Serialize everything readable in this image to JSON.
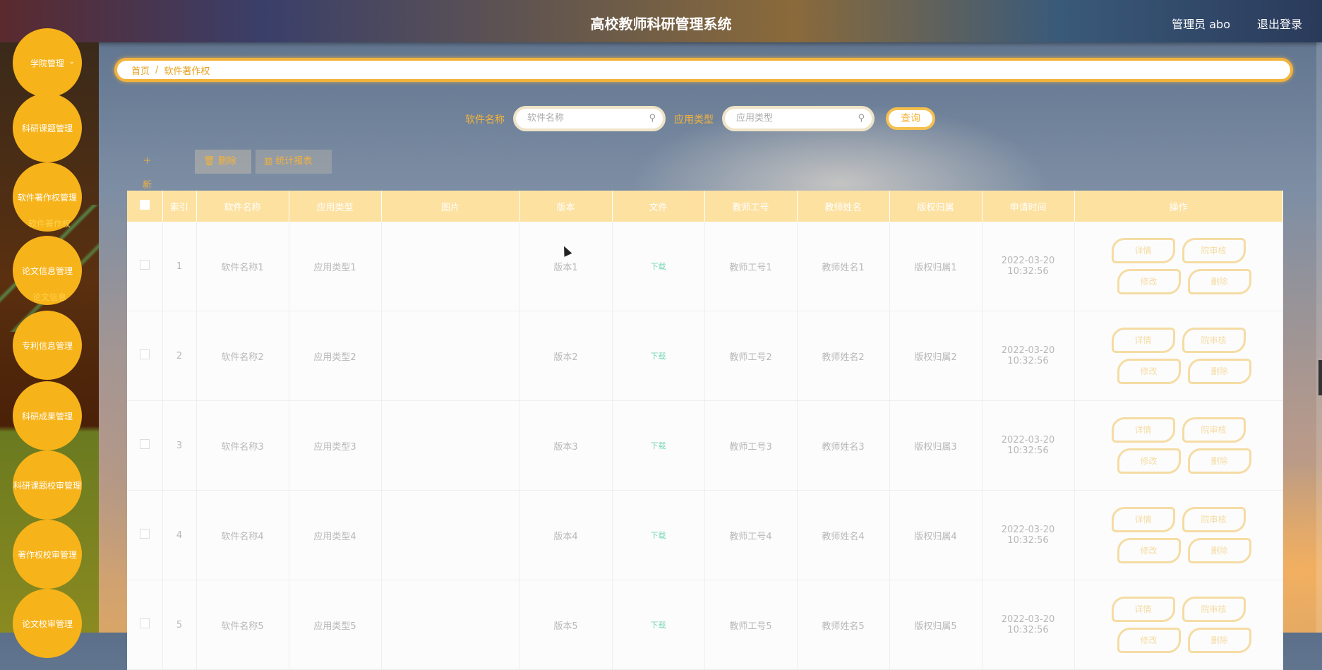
{
  "header": {
    "title": "高校教师科研管理系统",
    "admin": "管理员 abo",
    "logout": "退出登录"
  },
  "sidebar": {
    "items": [
      {
        "label": "学院管理"
      },
      {
        "label": "科研课题管理"
      },
      {
        "label": "软件著作权管理"
      },
      {
        "label": "论文信息管理"
      },
      {
        "label": "专利信息管理"
      },
      {
        "label": "科研成果管理"
      },
      {
        "label": "科研课题校审管理"
      },
      {
        "label": "著作权校审管理"
      },
      {
        "label": "论文校审管理"
      }
    ],
    "sub_labels": [
      "软件著作权",
      "论文信息"
    ]
  },
  "breadcrumb": {
    "home": "首页",
    "separator": "/",
    "current": "软件著作权"
  },
  "search": {
    "name_label": "软件名称",
    "name_placeholder": "软件名称",
    "type_label": "应用类型",
    "type_placeholder": "应用类型",
    "query": "查询"
  },
  "toolbar": {
    "add": "新增",
    "delete": "删除",
    "report": "统计报表"
  },
  "table": {
    "headers": [
      "索引",
      "软件名称",
      "应用类型",
      "图片",
      "版本",
      "文件",
      "教师工号",
      "教师姓名",
      "版权归属",
      "申请时间",
      "操作"
    ],
    "rows": [
      {
        "index": "1",
        "name": "软件名称1",
        "type": "应用类型1",
        "version": "版本1",
        "file": "下载",
        "tid": "教师工号1",
        "tname": "教师姓名1",
        "owner": "版权归属1",
        "time": "2022-03-20 10:32:56"
      },
      {
        "index": "2",
        "name": "软件名称2",
        "type": "应用类型2",
        "version": "版本2",
        "file": "下载",
        "tid": "教师工号2",
        "tname": "教师姓名2",
        "owner": "版权归属2",
        "time": "2022-03-20 10:32:56"
      },
      {
        "index": "3",
        "name": "软件名称3",
        "type": "应用类型3",
        "version": "版本3",
        "file": "下载",
        "tid": "教师工号3",
        "tname": "教师姓名3",
        "owner": "版权归属3",
        "time": "2022-03-20 10:32:56"
      },
      {
        "index": "4",
        "name": "软件名称4",
        "type": "应用类型4",
        "version": "版本4",
        "file": "下载",
        "tid": "教师工号4",
        "tname": "教师姓名4",
        "owner": "版权归属4",
        "time": "2022-03-20 10:32:56"
      },
      {
        "index": "5",
        "name": "软件名称5",
        "type": "应用类型5",
        "version": "版本5",
        "file": "下载",
        "tid": "教师工号5",
        "tname": "教师姓名5",
        "owner": "版权归属5",
        "time": "2022-03-20 10:32:56"
      }
    ],
    "ops": {
      "detail": "详情",
      "audit": "院审核",
      "edit": "修改",
      "delete": "删除"
    }
  },
  "colors": {
    "accent": "#f7b31a",
    "header_bg": "#fde1a0",
    "download": "#7bd6b8"
  },
  "icons": {
    "search": "search-icon",
    "add": "plus-icon",
    "delete": "trash-icon",
    "report": "bar-chart-icon"
  }
}
